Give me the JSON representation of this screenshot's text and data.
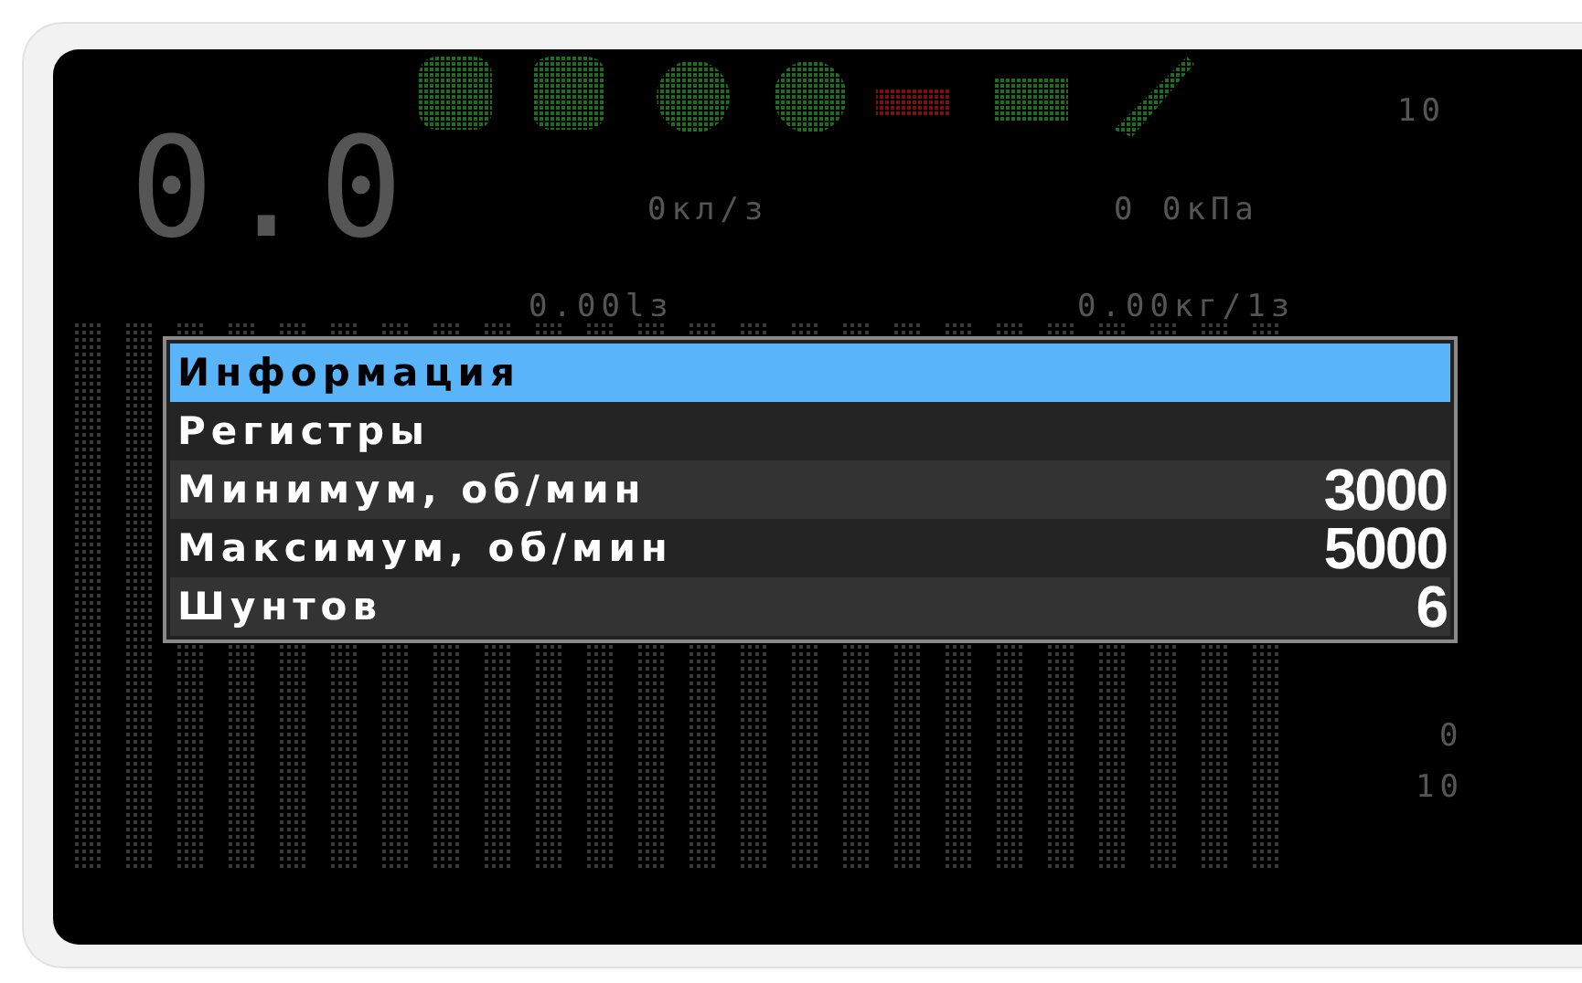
{
  "display": {
    "readouts": [
      {
        "text": "0.0",
        "kind": "large"
      },
      {
        "text": "10",
        "kind": "small"
      },
      {
        "text": "0кл/з",
        "kind": "small"
      },
      {
        "text": "0 0кПа",
        "kind": "small"
      },
      {
        "text": "0.00lз",
        "kind": "small"
      },
      {
        "text": "0.00кг/1з",
        "kind": "small"
      },
      {
        "text": "0",
        "kind": "small"
      },
      {
        "text": "10",
        "kind": "small"
      }
    ]
  },
  "menu": {
    "items": [
      {
        "label": "Информация",
        "selected": true
      },
      {
        "label": "Регистры",
        "selected": false
      },
      {
        "label": "Минимум, об/мин",
        "value": "3000",
        "selected": false
      },
      {
        "label": "Максимум, об/мин",
        "value": "5000",
        "selected": false
      },
      {
        "label": "Шунтов",
        "value": "6",
        "selected": false
      }
    ]
  }
}
